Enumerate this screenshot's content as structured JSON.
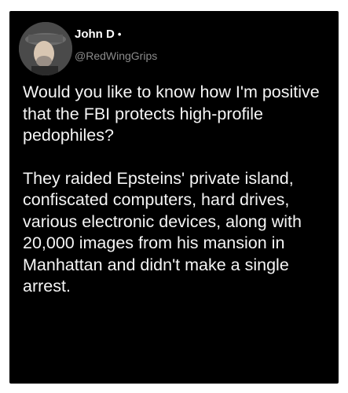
{
  "author": {
    "display_name": "John D",
    "status_dot": "•",
    "handle": "@RedWingGrips",
    "avatar_icon": "profile-photo"
  },
  "tweet": {
    "paragraphs": [
      "Would you like to know how I'm positive that the FBI protects high-profile pedophiles?",
      "They raided Epsteins' private island, confiscated computers, hard drives, various electronic devices, along with 20,000 images from his mansion in Manhattan and didn't make a single arrest."
    ]
  },
  "colors": {
    "background": "#000000",
    "text": "#f5f5f5",
    "handle": "#8b8b8b"
  }
}
